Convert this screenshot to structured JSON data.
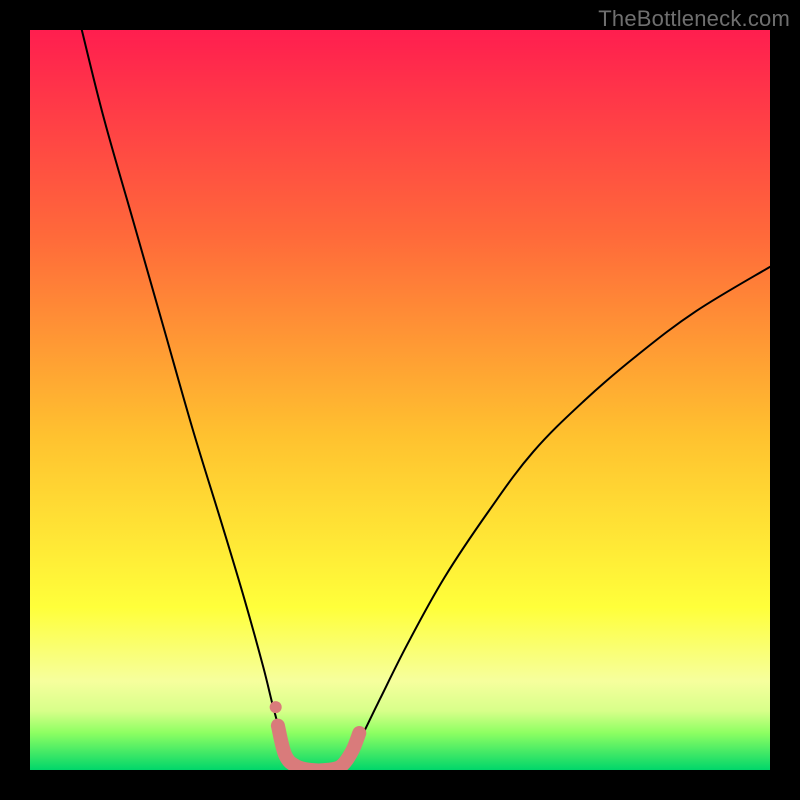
{
  "watermark": "TheBottleneck.com",
  "chart_data": {
    "type": "line",
    "title": "",
    "xlabel": "",
    "ylabel": "",
    "xlim": [
      0,
      100
    ],
    "ylim": [
      0,
      100
    ],
    "background_gradient": {
      "top": "#ff1e4f",
      "mid1": "#ff8a2b",
      "mid2": "#ffe92f",
      "bottom_band": "#f8ffae",
      "green_top": "#7dff5c",
      "green_bottom": "#00d76a"
    },
    "series": [
      {
        "name": "bottleneck-curve",
        "color": "#000000",
        "points": [
          {
            "x": 7.0,
            "y": 100.0
          },
          {
            "x": 10.0,
            "y": 88.0
          },
          {
            "x": 14.0,
            "y": 74.0
          },
          {
            "x": 18.0,
            "y": 60.0
          },
          {
            "x": 22.0,
            "y": 46.0
          },
          {
            "x": 26.0,
            "y": 33.0
          },
          {
            "x": 29.0,
            "y": 23.0
          },
          {
            "x": 31.5,
            "y": 14.0
          },
          {
            "x": 33.0,
            "y": 8.0
          },
          {
            "x": 34.5,
            "y": 3.0
          },
          {
            "x": 36.0,
            "y": 0.5
          },
          {
            "x": 38.0,
            "y": 0.0
          },
          {
            "x": 40.0,
            "y": 0.0
          },
          {
            "x": 42.0,
            "y": 0.5
          },
          {
            "x": 44.0,
            "y": 3.0
          },
          {
            "x": 47.0,
            "y": 9.0
          },
          {
            "x": 51.0,
            "y": 17.0
          },
          {
            "x": 56.0,
            "y": 26.0
          },
          {
            "x": 62.0,
            "y": 35.0
          },
          {
            "x": 68.0,
            "y": 43.0
          },
          {
            "x": 75.0,
            "y": 50.0
          },
          {
            "x": 82.0,
            "y": 56.0
          },
          {
            "x": 90.0,
            "y": 62.0
          },
          {
            "x": 100.0,
            "y": 68.0
          }
        ]
      },
      {
        "name": "highlight-band",
        "color": "#d97b7b",
        "stroke_width": 14,
        "points": [
          {
            "x": 33.5,
            "y": 6.0
          },
          {
            "x": 34.5,
            "y": 2.0
          },
          {
            "x": 36.0,
            "y": 0.5
          },
          {
            "x": 38.0,
            "y": 0.0
          },
          {
            "x": 40.0,
            "y": 0.0
          },
          {
            "x": 42.0,
            "y": 0.5
          },
          {
            "x": 43.5,
            "y": 2.5
          },
          {
            "x": 44.5,
            "y": 5.0
          }
        ]
      },
      {
        "name": "highlight-dot",
        "color": "#d97b7b",
        "radius": 6,
        "point": {
          "x": 33.2,
          "y": 8.5
        }
      }
    ]
  }
}
